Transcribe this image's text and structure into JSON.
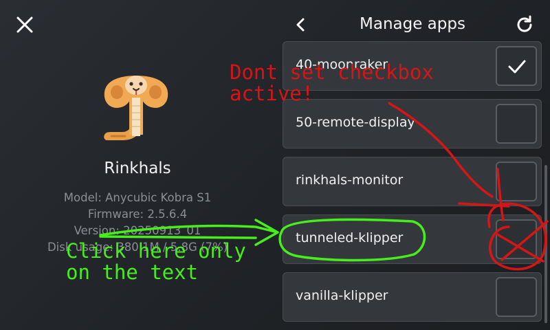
{
  "left_panel": {
    "app_name": "Rinkhals",
    "info": [
      "Model: Anycubic Kobra S1",
      "Firmware: 2.5.6.4",
      "Version: 20250913_01",
      "Disk usage: 380.1M / 5.8G (7%)"
    ]
  },
  "header": {
    "title": "Manage apps"
  },
  "apps": [
    {
      "name": "40-moonraker",
      "checked": true
    },
    {
      "name": "50-remote-display",
      "checked": false
    },
    {
      "name": "rinkhals-monitor",
      "checked": false
    },
    {
      "name": "tunneled-klipper",
      "checked": false
    },
    {
      "name": "vanilla-klipper",
      "checked": false
    }
  ],
  "annotations": {
    "red_note": "Dont set checkbox\nactive!",
    "green_note": "Click here only\non the text",
    "red_color": "#d61616",
    "green_color": "#47ee1c"
  },
  "colors": {
    "background": "#25292d",
    "row_background": "#34383d",
    "row_border": "#4a4e53",
    "secondary_text": "#8b8f94"
  },
  "icons": [
    "close-icon",
    "snake-logo",
    "chevron-left-icon",
    "refresh-icon",
    "checkmark-icon"
  ]
}
